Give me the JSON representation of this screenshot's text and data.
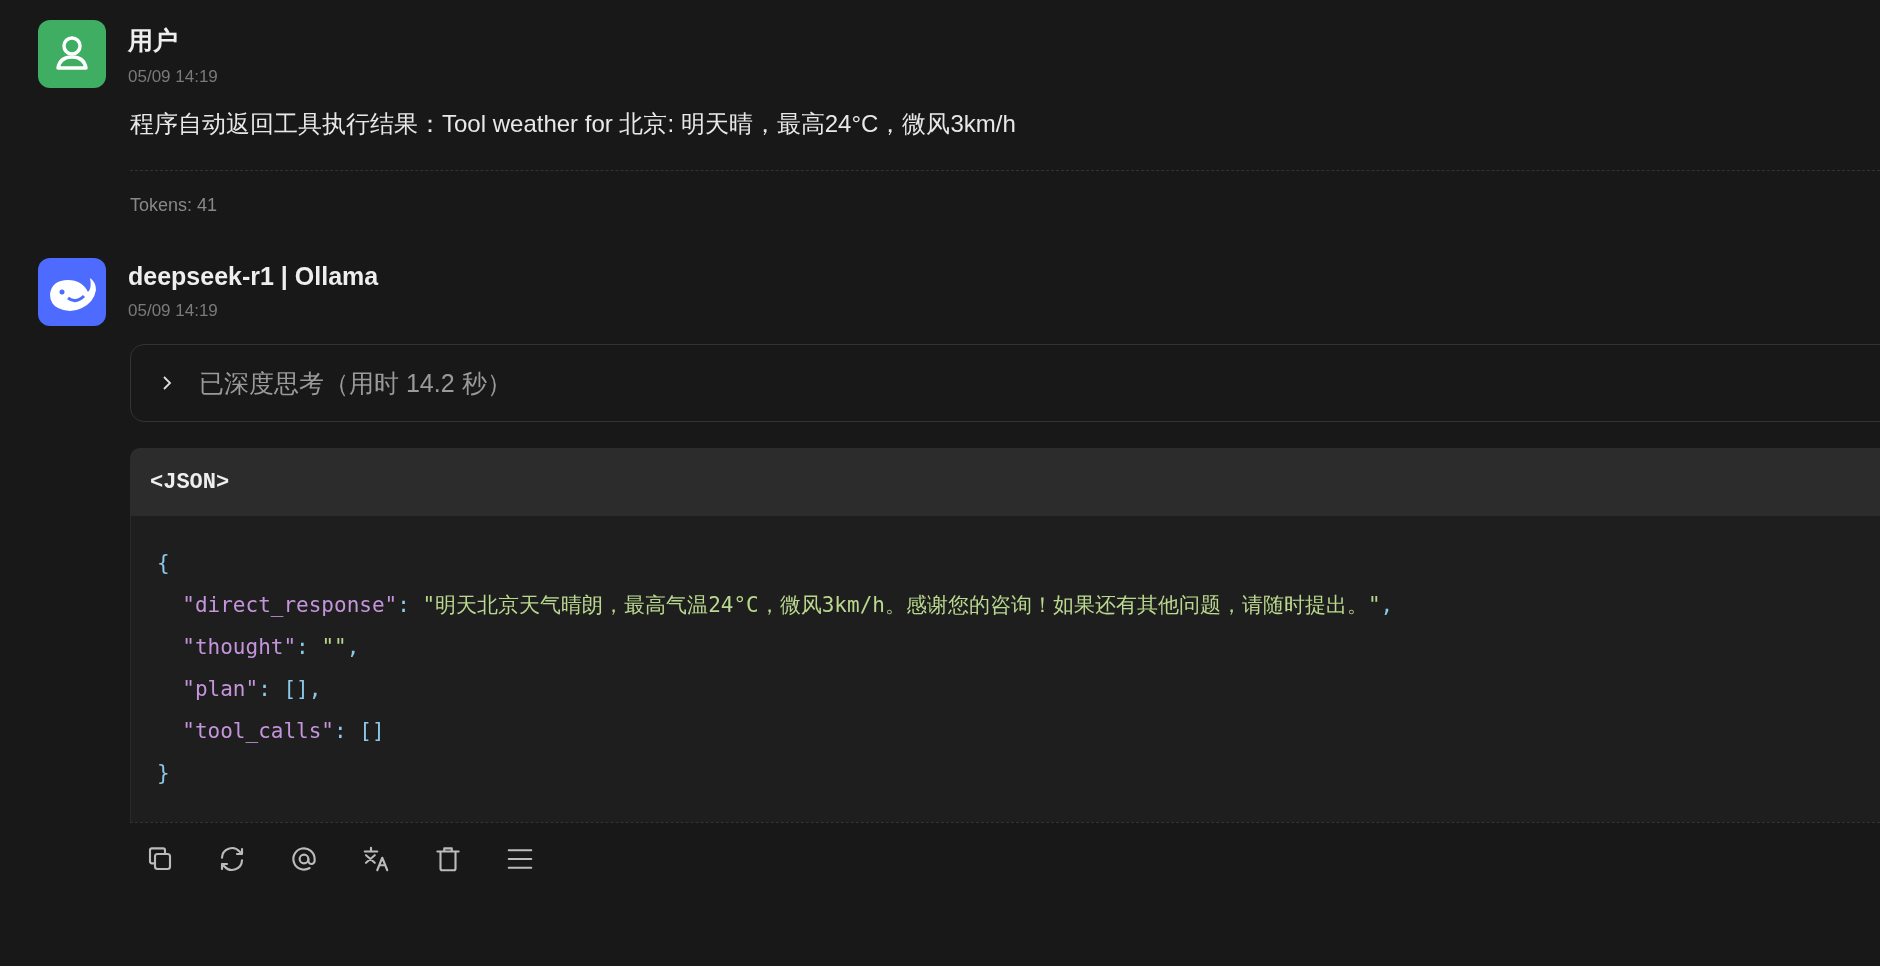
{
  "messages": [
    {
      "kind": "user",
      "author": "用户",
      "time": "05/09 14:19",
      "text": "程序自动返回工具执行结果：Tool weather for 北京: 明天晴，最高24°C，微风3km/h",
      "tokens": "Tokens: 41"
    },
    {
      "kind": "assistant",
      "author": "deepseek-r1 | Ollama",
      "time": "05/09 14:19",
      "thinking": {
        "label": "已深度思考（用时 14.2 秒）",
        "expanded": false
      },
      "code": {
        "language": "<JSON>",
        "lines": [
          [
            {
              "kind": "punct",
              "text": "{"
            }
          ],
          [
            {
              "kind": "key",
              "text": "  \"direct_response\""
            },
            {
              "kind": "punct",
              "text": ": "
            },
            {
              "kind": "string",
              "text": "\"明天北京天气晴朗，最高气温24°C，微风3km/h。感谢您的咨询！如果还有其他问题，请随时提出。\""
            },
            {
              "kind": "punct",
              "text": ","
            }
          ],
          [
            {
              "kind": "key",
              "text": "  \"thought\""
            },
            {
              "kind": "punct",
              "text": ": "
            },
            {
              "kind": "string",
              "text": "\"\""
            },
            {
              "kind": "punct",
              "text": ","
            }
          ],
          [
            {
              "kind": "key",
              "text": "  \"plan\""
            },
            {
              "kind": "punct",
              "text": ": [],"
            }
          ],
          [
            {
              "kind": "key",
              "text": "  \"tool_calls\""
            },
            {
              "kind": "punct",
              "text": ": []"
            }
          ],
          [
            {
              "kind": "punct",
              "text": "}"
            }
          ]
        ]
      }
    }
  ]
}
